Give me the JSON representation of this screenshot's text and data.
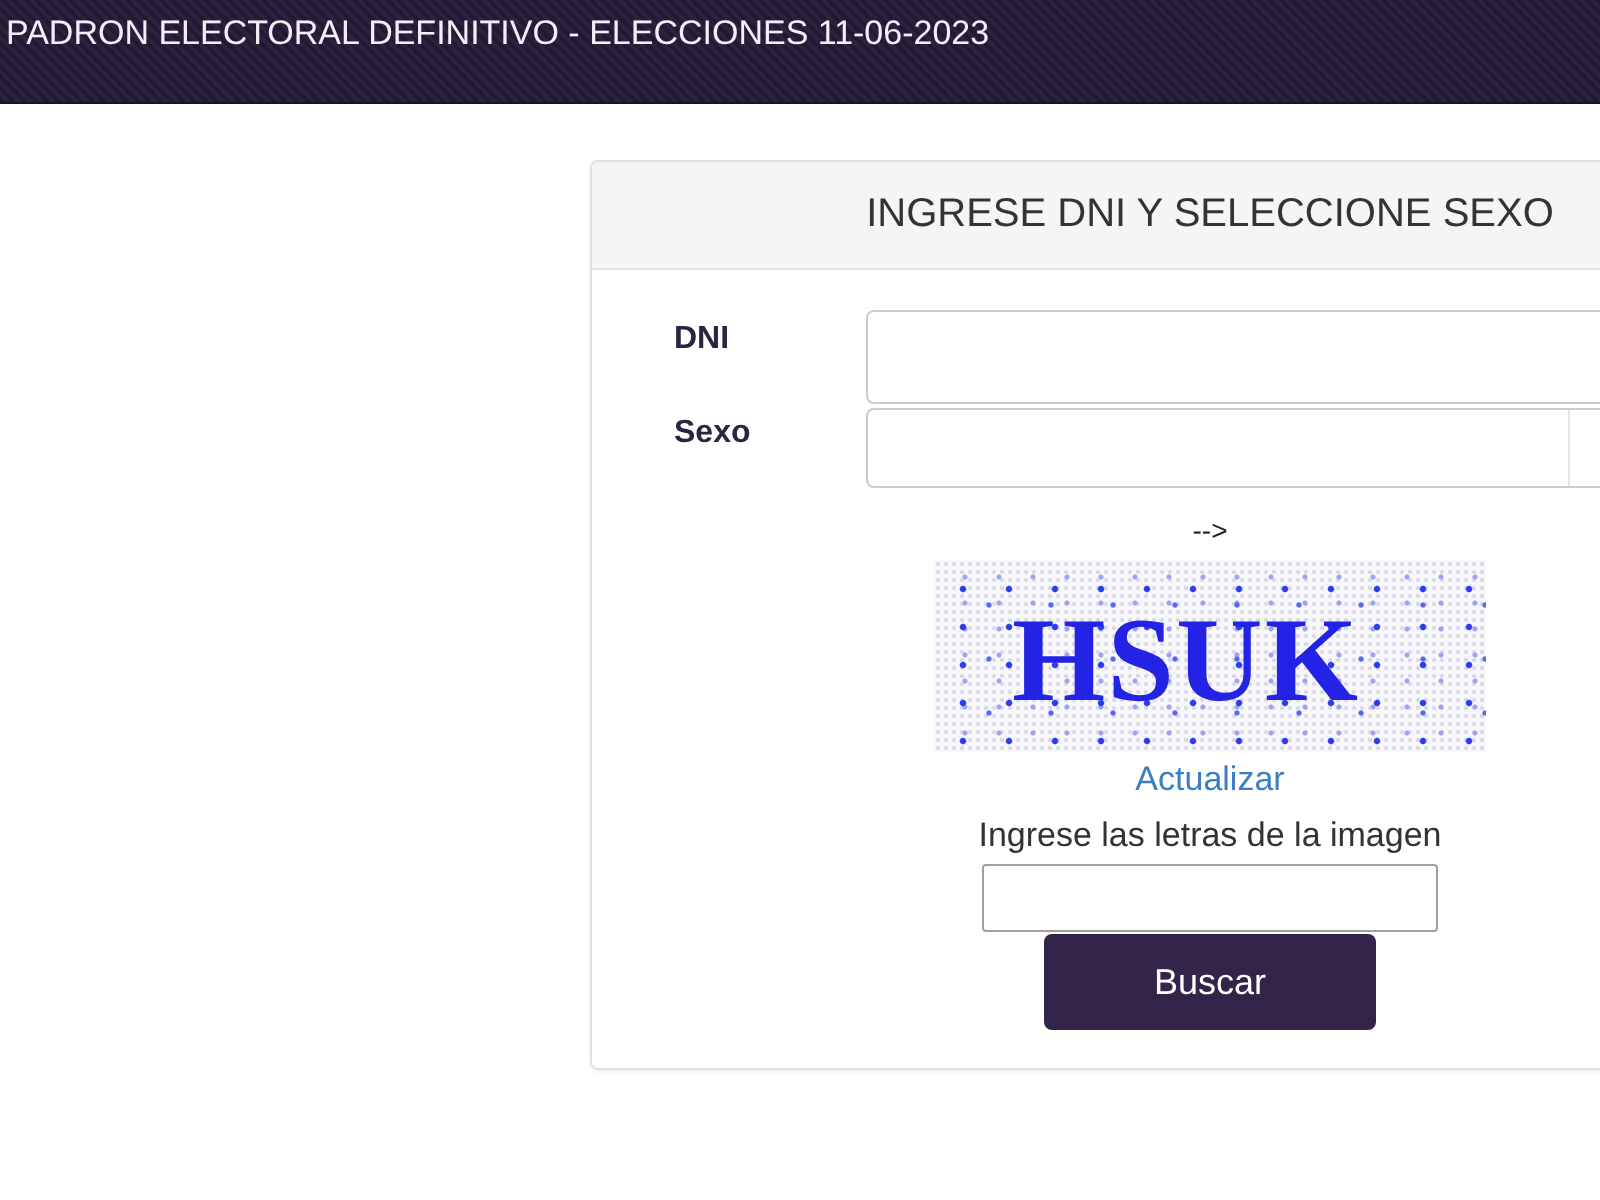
{
  "header": {
    "title": "PADRON ELECTORAL DEFINITIVO - ELECCIONES 11-06-2023"
  },
  "form": {
    "title": "INGRESE DNI Y SELECCIONE SEXO",
    "fields": [
      {
        "kind": "text",
        "label": "DNI"
      },
      {
        "kind": "select",
        "label": "Sexo"
      }
    ],
    "arrow_text": "-->",
    "captcha": {
      "text": "HSUK",
      "refresh_link": "Actualizar",
      "prompt": "Ingrese las letras de la imagen"
    },
    "submit_button": "Buscar"
  }
}
